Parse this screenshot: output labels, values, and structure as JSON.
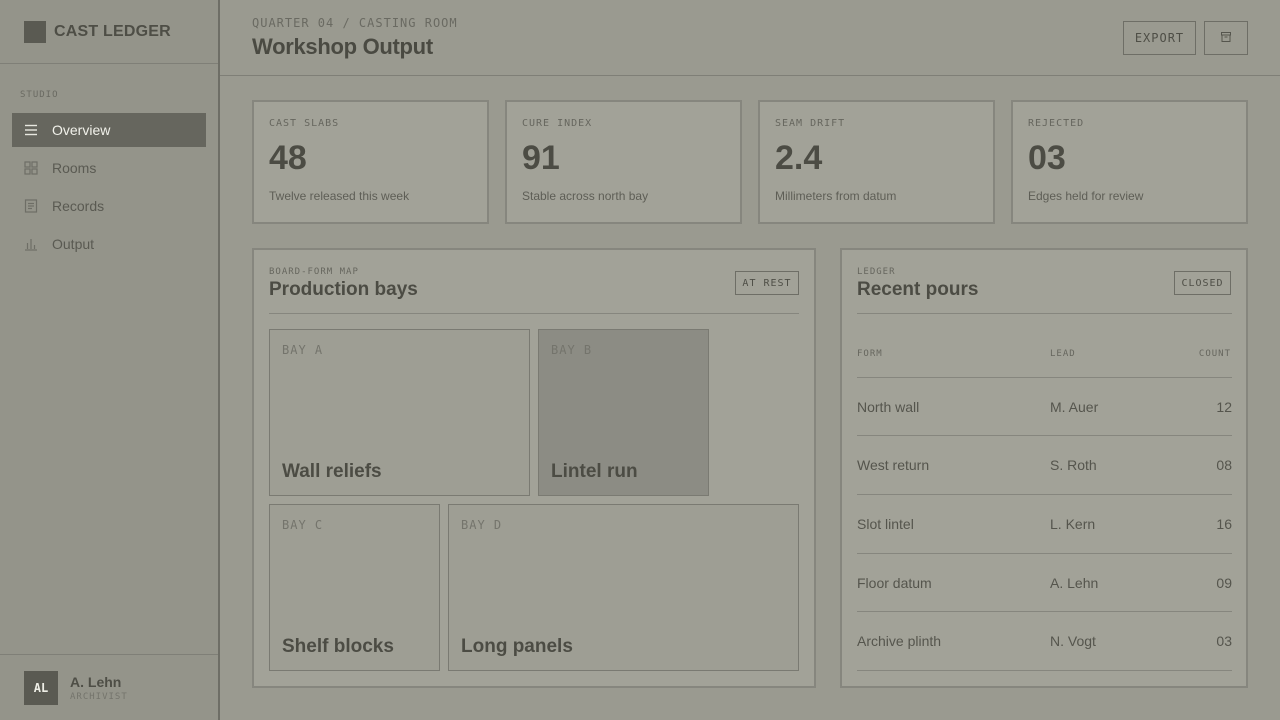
{
  "brand": {
    "name": "CAST LEDGER"
  },
  "sidebar": {
    "section_label": "STUDIO",
    "items": [
      {
        "label": "Overview",
        "icon": "menu-icon",
        "active": true
      },
      {
        "label": "Rooms",
        "icon": "grid-icon",
        "active": false
      },
      {
        "label": "Records",
        "icon": "document-icon",
        "active": false
      },
      {
        "label": "Output",
        "icon": "bar-chart-icon",
        "active": false
      }
    ]
  },
  "user": {
    "initials": "AL",
    "name": "A. Lehn",
    "role": "ARCHIVIST"
  },
  "header": {
    "breadcrumb": "QUARTER 04 / CASTING ROOM",
    "title": "Workshop Output",
    "export_label": "EXPORT",
    "archive_icon": "archive-icon"
  },
  "stats": [
    {
      "label": "CAST SLABS",
      "value": "48",
      "caption": "Twelve released this week"
    },
    {
      "label": "CURE INDEX",
      "value": "91",
      "caption": "Stable across north bay"
    },
    {
      "label": "SEAM DRIFT",
      "value": "2.4",
      "caption": "Millimeters from datum"
    },
    {
      "label": "REJECTED",
      "value": "03",
      "caption": "Edges held for review"
    }
  ],
  "map": {
    "kicker": "BOARD-FORM MAP",
    "title": "Production bays",
    "badge": "AT REST",
    "bays": [
      {
        "code": "BAY A",
        "name": "Wall reliefs"
      },
      {
        "code": "BAY B",
        "name": "Lintel run"
      },
      {
        "code": "BAY C",
        "name": "Shelf blocks"
      },
      {
        "code": "BAY D",
        "name": "Long panels"
      }
    ]
  },
  "ledger": {
    "kicker": "LEDGER",
    "title": "Recent pours",
    "badge": "CLOSED",
    "columns": [
      "FORM",
      "LEAD",
      "COUNT"
    ],
    "rows": [
      {
        "form": "North wall",
        "lead": "M. Auer",
        "count": "12"
      },
      {
        "form": "West return",
        "lead": "S. Roth",
        "count": "08"
      },
      {
        "form": "Slot lintel",
        "lead": "L. Kern",
        "count": "16"
      },
      {
        "form": "Floor datum",
        "lead": "A. Lehn",
        "count": "09"
      },
      {
        "form": "Archive plinth",
        "lead": "N. Vogt",
        "count": "03"
      }
    ]
  },
  "colors": {
    "background": "#9a9a90",
    "sidebar": "#94948a",
    "active_nav": "#66665e",
    "card": "#a2a298",
    "text": "#4a4a42"
  }
}
